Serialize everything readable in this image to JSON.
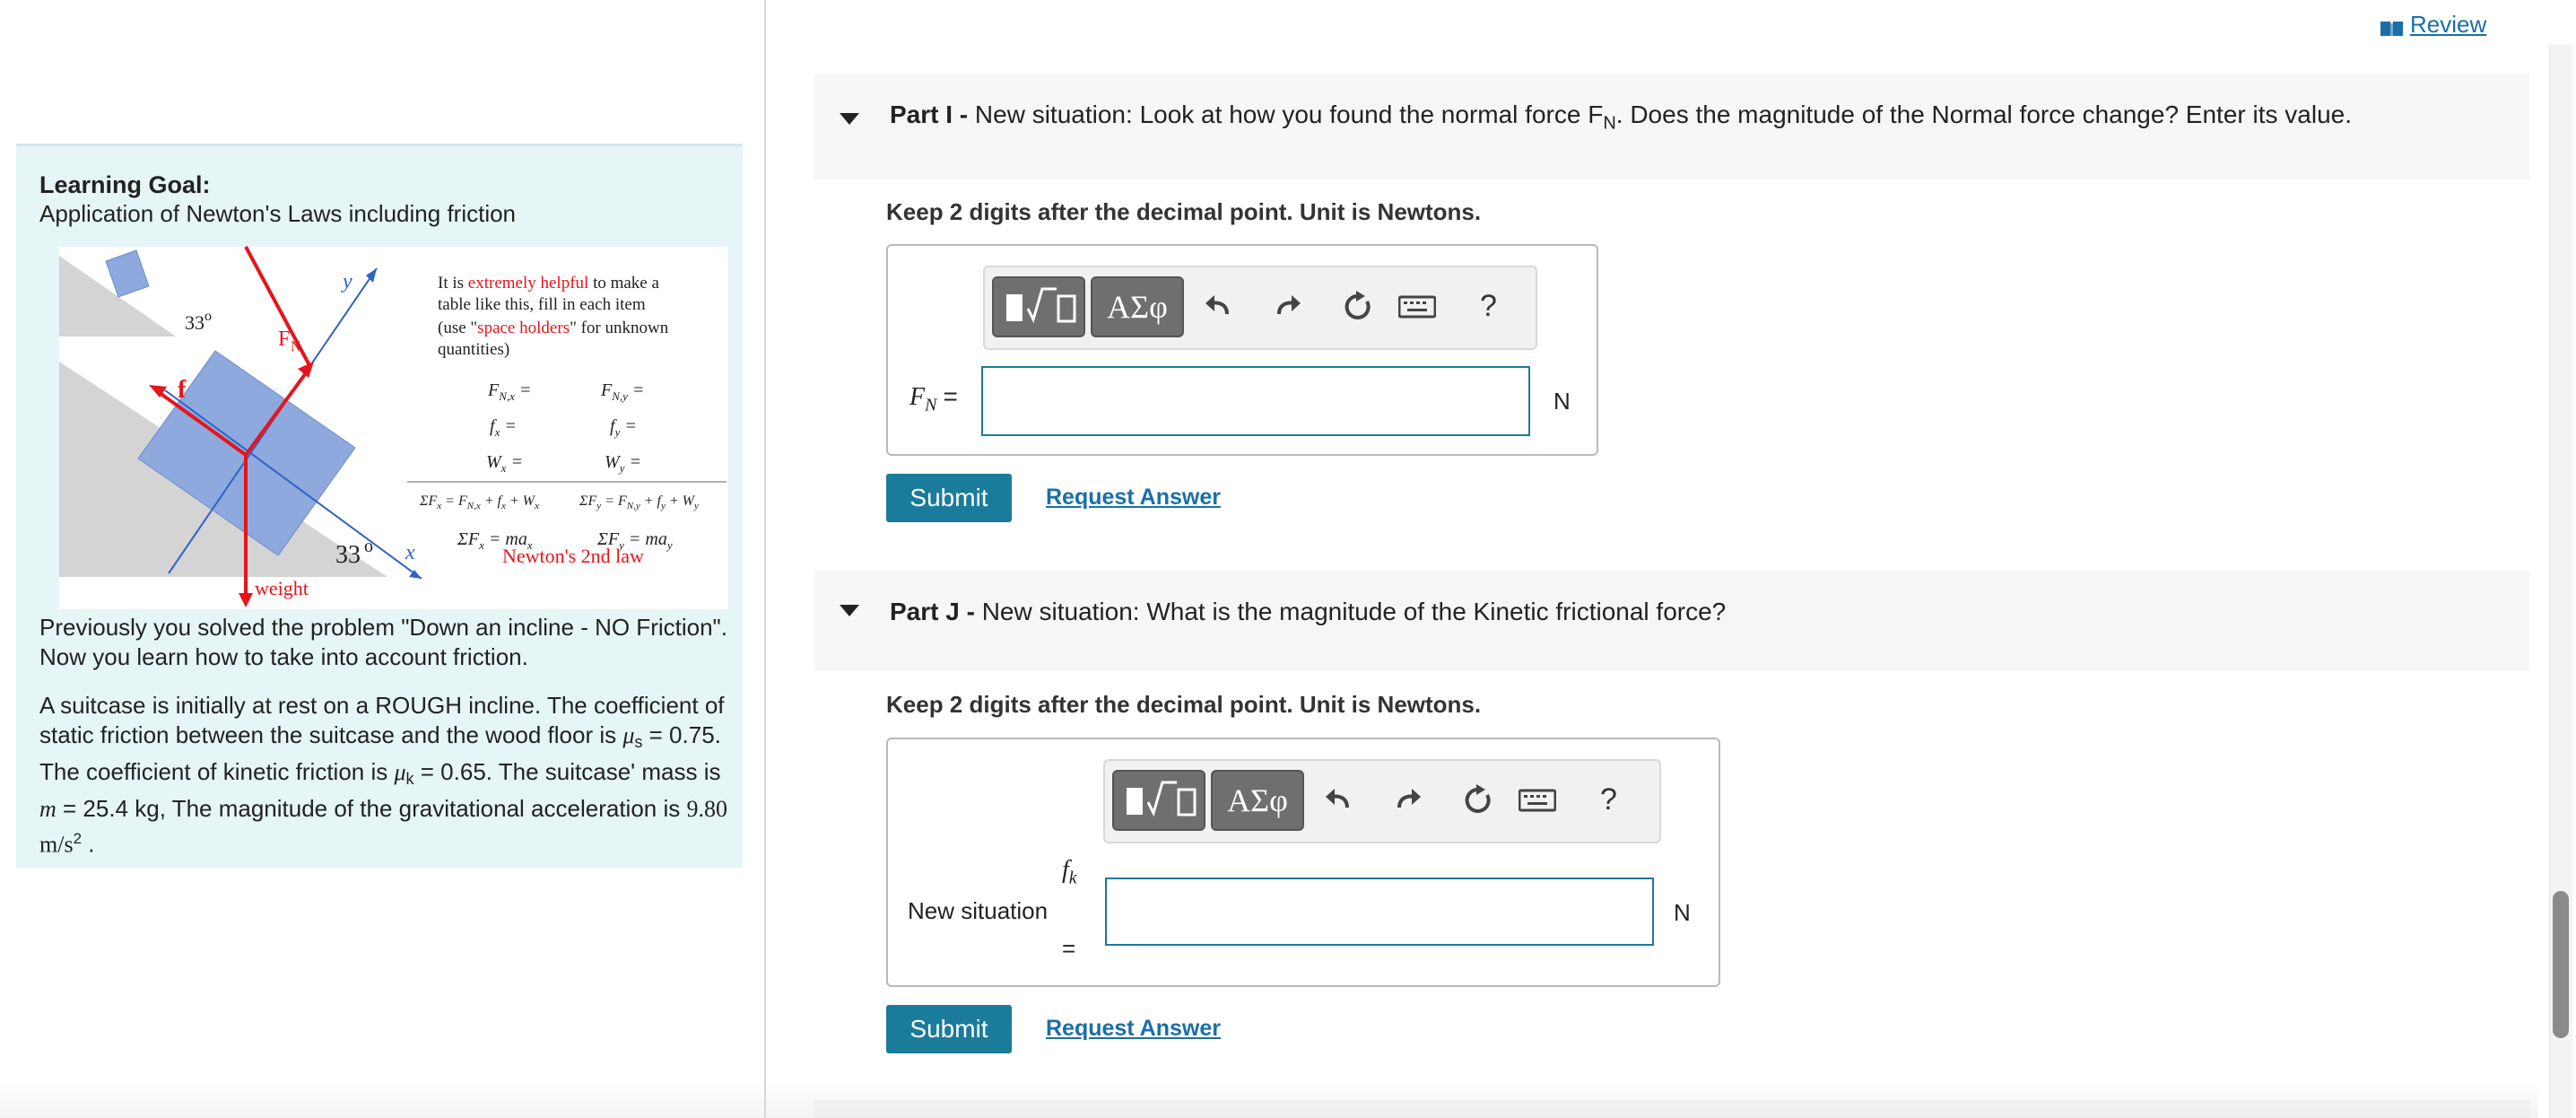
{
  "left": {
    "goal_title": "Learning Goal:",
    "goal_subtitle": "Application of Newton's Laws including friction",
    "figure": {
      "angle_small": "33",
      "angle_big": "33",
      "degree_mark": "o",
      "fn_label": "F",
      "fn_sub": "N",
      "f_label": "f",
      "weight_label": "weight",
      "y_axis": "y",
      "x_axis": "x",
      "note_line1_a": "It is ",
      "note_line1_b": "extremely helpful",
      "note_line1_c": " to make a",
      "note_line2": "table like this, fill in each item",
      "note_line3_a": "(use \"",
      "note_line3_b": "space holders",
      "note_line3_c": "\" for unknown",
      "note_line4": "quantities)",
      "newton_label": "Newton's 2nd law"
    },
    "intro_p1": "Previously you solved the problem \"Down an incline - NO Friction\". Now you learn how to take into account friction.",
    "intro_p2_a": "A suitcase is initially at rest on a ROUGH incline. The coefficient of static friction between the suitcase and the wood floor is ",
    "mu_s_symbol": "μ",
    "mu_s_sub": "s",
    "mu_s_value": " = 0.75",
    "intro_p2_b": ". The coefficient of kinetic friction is ",
    "mu_k_symbol": "μ",
    "mu_k_sub": "k",
    "mu_k_value": " = 0.65",
    "intro_p2_c": ". The suitcase' mass is ",
    "mass_symbol": "m",
    "mass_value": " = 25.4 kg",
    "intro_p2_d": ", The magnitude of the gravitational acceleration is ",
    "g_value": "9.80 m/s",
    "g_exp": "2",
    "intro_p2_e": " ."
  },
  "review": {
    "label": "Review"
  },
  "partI": {
    "prefix": "Part I - ",
    "question_a": "New situation: Look at how you found the normal force F",
    "question_sub": "N",
    "question_b": ". Does the magnitude of the Normal  force change? Enter its value.",
    "instruction": "Keep 2 digits after the decimal point. Unit is Newtons.",
    "greek_label": "ΑΣφ",
    "help_label": "?",
    "var_label": "F",
    "var_sub": "N",
    "equals": "=",
    "input_value": "",
    "unit": "N",
    "submit": "Submit",
    "request": "Request Answer"
  },
  "partJ": {
    "prefix": "Part J - ",
    "question": "New situation: What is the magnitude of the Kinetic frictional force?",
    "instruction": "Keep 2 digits after the decimal point. Unit is Newtons.",
    "greek_label": "ΑΣφ",
    "help_label": "?",
    "label_text": "New situation",
    "var_label": "f",
    "var_sub": "k",
    "equals": "=",
    "input_value": "",
    "unit": "N",
    "submit": "Submit",
    "request": "Request Answer"
  },
  "colors": {
    "accent": "#1a7b9b",
    "link": "#1a6fa8",
    "goal_bg": "#e6f5f6",
    "force_red": "#e8141b",
    "axis_blue": "#2f63c4",
    "block_blue": "#8da9dd"
  }
}
